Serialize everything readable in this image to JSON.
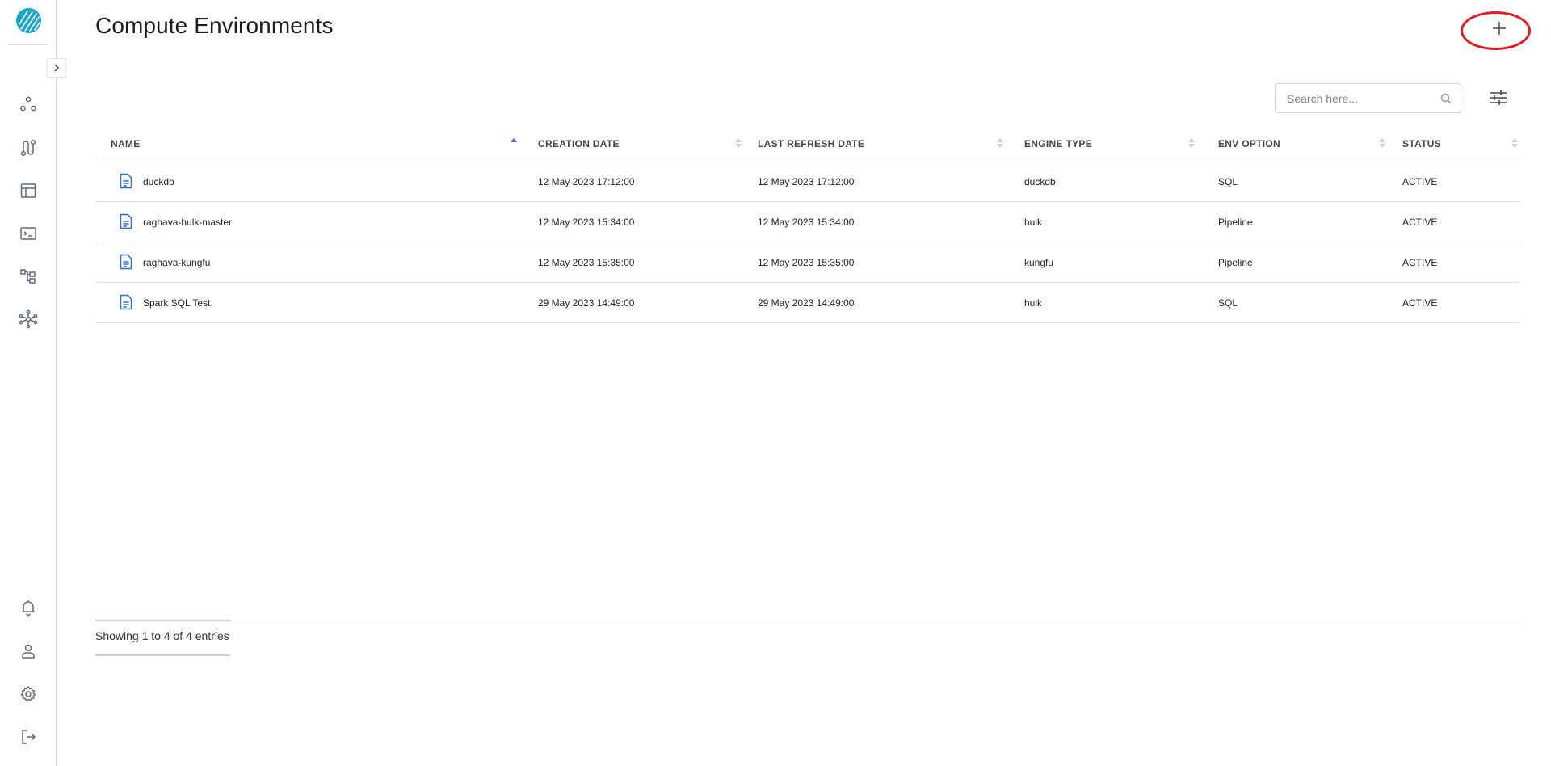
{
  "app": {
    "sidebar": {
      "logo_icon": "striped-globe-logo",
      "expand_icon": "chevron-right-icon",
      "nav_items": [
        {
          "name": "nav-workflows",
          "icon": "nodes-icon"
        },
        {
          "name": "nav-pipelines",
          "icon": "pipeline-icon"
        },
        {
          "name": "nav-tables",
          "icon": "table-icon"
        },
        {
          "name": "nav-console",
          "icon": "terminal-icon"
        },
        {
          "name": "nav-hierarchy",
          "icon": "hierarchy-icon"
        },
        {
          "name": "nav-network",
          "icon": "network-icon"
        }
      ],
      "bottom_items": [
        {
          "name": "nav-notifications",
          "icon": "bell-icon"
        },
        {
          "name": "nav-profile",
          "icon": "user-icon"
        },
        {
          "name": "nav-settings",
          "icon": "gear-icon"
        },
        {
          "name": "nav-logout",
          "icon": "logout-icon"
        }
      ]
    }
  },
  "header": {
    "title": "Compute Environments",
    "add_icon": "plus-icon",
    "highlight_color": "#e8171f"
  },
  "search": {
    "placeholder": "Search here...",
    "value": ""
  },
  "table": {
    "columns": [
      {
        "label": "NAME",
        "sort": "asc"
      },
      {
        "label": "CREATION DATE",
        "sort": "none"
      },
      {
        "label": "LAST REFRESH DATE",
        "sort": "none"
      },
      {
        "label": "ENGINE TYPE",
        "sort": "none"
      },
      {
        "label": "ENV OPTION",
        "sort": "none"
      },
      {
        "label": "STATUS",
        "sort": "none"
      }
    ],
    "rows": [
      {
        "name": "duckdb",
        "creation_date": "12 May 2023 17:12:00",
        "last_refresh_date": "12 May 2023 17:12:00",
        "engine_type": "duckdb",
        "env_option": "SQL",
        "status": "ACTIVE"
      },
      {
        "name": "raghava-hulk-master",
        "creation_date": "12 May 2023 15:34:00",
        "last_refresh_date": "12 May 2023 15:34:00",
        "engine_type": "hulk",
        "env_option": "Pipeline",
        "status": "ACTIVE"
      },
      {
        "name": "raghava-kungfu",
        "creation_date": "12 May 2023 15:35:00",
        "last_refresh_date": "12 May 2023 15:35:00",
        "engine_type": "kungfu",
        "env_option": "Pipeline",
        "status": "ACTIVE"
      },
      {
        "name": "Spark SQL Test",
        "creation_date": "29 May 2023 14:49:00",
        "last_refresh_date": "29 May 2023 14:49:00",
        "engine_type": "hulk",
        "env_option": "SQL",
        "status": "ACTIVE"
      }
    ]
  },
  "footer": {
    "entries_info": "Showing 1 to 4 of 4 entries"
  },
  "colors": {
    "accent": "#1aa6c9",
    "doc_icon": "#2a6fdb",
    "sort_active": "#4a68c4"
  }
}
